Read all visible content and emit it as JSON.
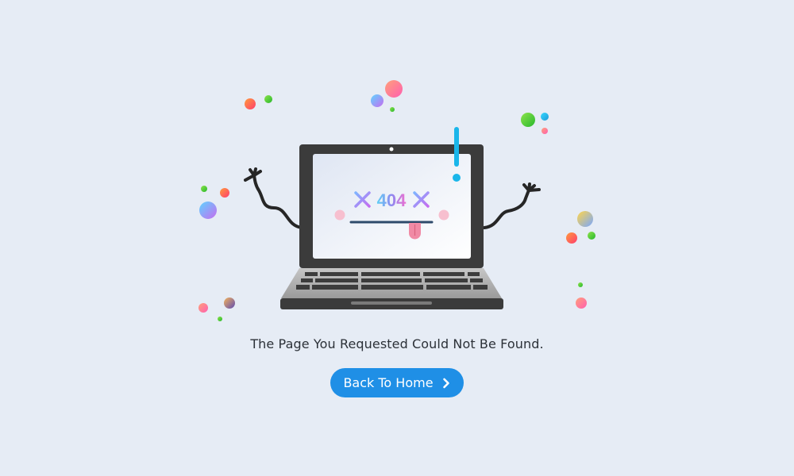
{
  "screen": {
    "code": "404",
    "message": "The Page You Requested Could Not Be Found.",
    "back_button_label": "Back To Home",
    "back_button_icon": "chevron-right-icon"
  },
  "colors": {
    "background": "#e6ecf5",
    "button": "#1f8fe6",
    "laptop_body": "#3b3b3b",
    "screen_glow": "#f4f6fb",
    "exclamation": "#1ab6ea"
  }
}
